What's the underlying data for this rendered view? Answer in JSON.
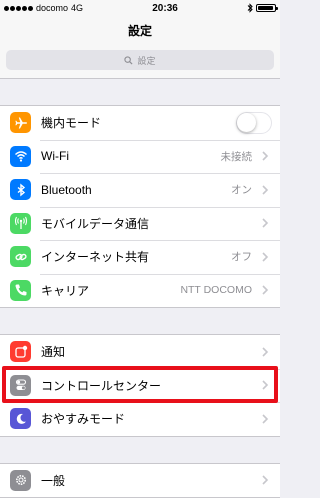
{
  "status_bar": {
    "carrier": "docomo",
    "network": "4G",
    "time": "20:36",
    "battery_level": 0.9
  },
  "nav": {
    "title": "設定"
  },
  "search": {
    "placeholder": "設定"
  },
  "groups": [
    {
      "items": [
        {
          "label": "機内モード",
          "icon": "airplane-icon",
          "color": "#ff9500",
          "control": "toggle",
          "toggle_on": false
        },
        {
          "label": "Wi-Fi",
          "icon": "wifi-icon",
          "color": "#007aff",
          "value": "未接続"
        },
        {
          "label": "Bluetooth",
          "icon": "bluetooth-icon",
          "color": "#007aff",
          "value": "オン"
        },
        {
          "label": "モバイルデータ通信",
          "icon": "cellular-icon",
          "color": "#4cd964"
        },
        {
          "label": "インターネット共有",
          "icon": "hotspot-icon",
          "color": "#4cd964",
          "value": "オフ"
        },
        {
          "label": "キャリア",
          "icon": "phone-icon",
          "color": "#4cd964",
          "value": "NTT DOCOMO"
        }
      ]
    },
    {
      "items": [
        {
          "label": "通知",
          "icon": "notifications-icon",
          "color": "#ff3b30"
        },
        {
          "label": "コントロールセンター",
          "icon": "control-center-icon",
          "color": "#8e8e93"
        },
        {
          "label": "おやすみモード",
          "icon": "moon-icon",
          "color": "#5856d6"
        }
      ]
    },
    {
      "items": [
        {
          "label": "一般",
          "icon": "gear-icon",
          "color": "#8e8e93"
        }
      ]
    }
  ],
  "highlight_color": "#e8101a"
}
